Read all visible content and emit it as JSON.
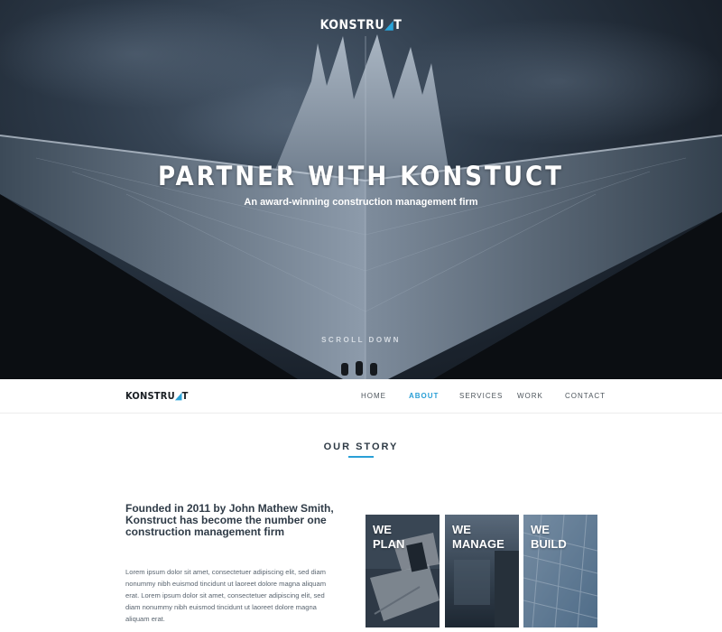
{
  "hero": {
    "logo_main": "KONSTRU",
    "logo_accent": "◢",
    "logo_tail": "T",
    "title": "PARTNER WITH KONSTUCT",
    "subtitle": "An award-winning construction management firm",
    "scroll_label": "SCROLL DOWN"
  },
  "nav": {
    "logo_main": "KONSTRU",
    "logo_accent": "◢",
    "logo_tail": "T",
    "links": [
      {
        "label": "HOME",
        "active": false
      },
      {
        "label": "ABOUT",
        "active": true
      },
      {
        "label": "SERVICES",
        "active": false
      },
      {
        "label": "WORK",
        "active": false
      },
      {
        "label": "CONTACT",
        "active": false
      }
    ]
  },
  "story": {
    "section_title": "OUR STORY",
    "heading": "Founded in 2011 by John Mathew Smith, Konstruct has become the number one construction management firm",
    "body": "Lorem ipsum dolor sit amet, consectetuer adipiscing elit, sed diam nonummy nibh euismod tincidunt ut laoreet dolore magna aliquam erat. Lorem ipsum dolor sit amet, consectetuer adipiscing elit, sed diam nonummy nibh euismod tincidunt ut laoreet dolore magna aliquam erat."
  },
  "cards": [
    {
      "line1": "WE",
      "line2": "PLAN"
    },
    {
      "line1": "WE",
      "line2": "MANAGE"
    },
    {
      "line1": "WE",
      "line2": "BUILD"
    }
  ],
  "colors": {
    "accent": "#2a9fd6",
    "hero_sky": "#2d3a49",
    "heading_text": "#2f3b47"
  }
}
